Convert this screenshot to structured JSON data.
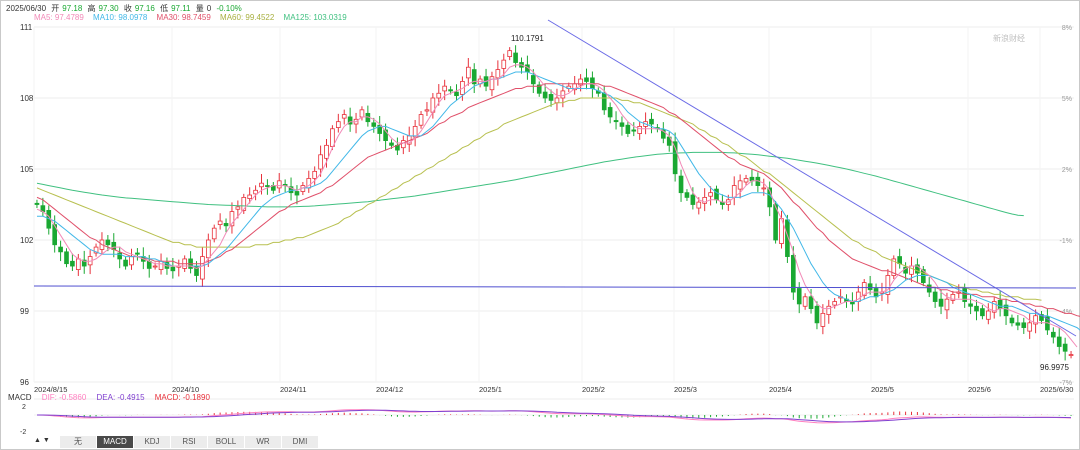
{
  "header": {
    "date": "2025/06/30",
    "open_label": "开",
    "open": "97.18",
    "high_label": "高",
    "high": "97.30",
    "close_label": "收",
    "close": "97.16",
    "low_label": "低",
    "low": "97.11",
    "vol_label": "量",
    "vol": "0",
    "change": "-0.10%"
  },
  "ma_legend": {
    "ma5": "MA5: 97.4789",
    "ma10": "MA10: 98.0978",
    "ma30": "MA30: 98.7459",
    "ma60": "MA60: 99.4522",
    "ma125": "MA125: 103.0319"
  },
  "macd_legend": {
    "title": "MACD",
    "dif": "DIF: -0.5860",
    "dea": "DEA: -0.4915",
    "macd": "MACD: -0.1890"
  },
  "watermark": "新浪财经",
  "annotations": {
    "high_label": "110.1791",
    "low_label": "96.9975"
  },
  "tabs": [
    "无",
    "MACD",
    "KDJ",
    "RSI",
    "BOLL",
    "WR",
    "DMI"
  ],
  "active_tab": "MACD",
  "colors": {
    "up": "#e8313b",
    "down": "#1aa832",
    "ma5": "#f28ab8",
    "ma10": "#42b8e8",
    "ma30": "#e0506a",
    "ma60": "#b8c050",
    "ma125": "#40c080",
    "trendline": "#6060e0",
    "support": "#5050d0",
    "dif": "#ff80c0",
    "dea": "#8040d0"
  },
  "chart_data": {
    "type": "candlestick",
    "y_ticks": [
      "111",
      "108",
      "105",
      "102",
      "99",
      "96"
    ],
    "y_right_ticks": [
      "8%",
      "5%",
      "2%",
      "-1%",
      "-4%",
      "-7%"
    ],
    "x_ticks": [
      "2024/8/15",
      "2024/10",
      "2024/11",
      "2024/12",
      "2025/1",
      "2025/2",
      "2025/3",
      "2025/4",
      "2025/5",
      "2025/6",
      "2025/6/30"
    ],
    "ylim": [
      96,
      111
    ],
    "macd_ticks": [
      "2",
      "-2"
    ],
    "closes": [
      103.5,
      103.2,
      102.5,
      101.8,
      101.5,
      101.0,
      100.9,
      101.2,
      100.9,
      101.3,
      101.7,
      102.0,
      101.8,
      101.6,
      101.2,
      100.9,
      101.3,
      101.4,
      101.1,
      100.8,
      100.9,
      101.1,
      100.8,
      100.7,
      100.9,
      101.2,
      100.8,
      100.5,
      101.3,
      102.0,
      102.5,
      102.8,
      102.6,
      103.2,
      103.4,
      103.8,
      103.9,
      104.1,
      104.4,
      104.3,
      104.1,
      104.5,
      104.3,
      104.0,
      103.9,
      104.3,
      104.6,
      104.9,
      105.6,
      106.0,
      106.7,
      107.0,
      107.3,
      106.9,
      107.1,
      107.5,
      107.0,
      106.8,
      106.5,
      106.2,
      106.0,
      105.8,
      106.2,
      106.4,
      106.8,
      107.3,
      107.5,
      108.0,
      108.2,
      108.5,
      108.3,
      108.1,
      108.7,
      109.3,
      108.6,
      108.8,
      108.5,
      108.9,
      109.2,
      109.6,
      110.0,
      109.5,
      109.3,
      109.1,
      108.6,
      108.2,
      108.0,
      107.9,
      108.0,
      108.3,
      108.5,
      108.6,
      108.8,
      108.7,
      108.4,
      108.2,
      107.5,
      107.2,
      107.0,
      106.8,
      106.5,
      106.6,
      106.8,
      107.0,
      106.9,
      106.7,
      106.3,
      106.0,
      104.8,
      104.0,
      103.8,
      103.5,
      103.6,
      103.8,
      104.0,
      103.7,
      103.5,
      103.7,
      104.3,
      104.5,
      104.6,
      104.5,
      104.3,
      104.2,
      103.4,
      102.0,
      102.9,
      101.3,
      99.8,
      99.3,
      99.6,
      99.1,
      98.5,
      98.9,
      99.2,
      99.4,
      99.6,
      99.4,
      99.3,
      99.8,
      100.2,
      99.9,
      99.6,
      99.8,
      100.5,
      101.2,
      101.0,
      100.6,
      100.9,
      100.6,
      100.2,
      99.8,
      99.4,
      99.2,
      99.5,
      99.7,
      99.8,
      99.4,
      99.2,
      99.0,
      98.8,
      99.0,
      99.4,
      99.1,
      98.8,
      98.5,
      98.4,
      98.3,
      98.5,
      98.8,
      98.6,
      98.2,
      97.9,
      97.5,
      97.3,
      97.16
    ],
    "ma5": [
      103.3,
      103.2,
      103.0,
      102.6,
      102.2,
      101.8,
      101.4,
      101.2,
      101.1,
      101.1,
      101.2,
      101.4,
      101.6,
      101.7,
      101.7,
      101.5,
      101.4,
      101.3,
      101.2,
      101.1,
      101.0,
      101.0,
      100.9,
      100.9,
      100.9,
      100.9,
      100.9,
      100.8,
      100.9,
      101.2,
      101.5,
      101.8,
      102.3,
      102.7,
      103.0,
      103.3,
      103.6,
      103.9,
      104.1,
      104.2,
      104.3,
      104.3,
      104.3,
      104.2,
      104.1,
      104.2,
      104.3,
      104.5,
      104.8,
      105.3,
      105.9,
      106.4,
      106.8,
      107.0,
      107.0,
      107.2,
      107.2,
      107.1,
      106.9,
      106.6,
      106.3,
      106.1,
      106.1,
      106.1,
      106.3,
      106.6,
      107.0,
      107.4,
      107.8,
      108.1,
      108.2,
      108.3,
      108.4,
      108.6,
      108.7,
      108.7,
      108.7,
      108.8,
      108.8,
      109.0,
      109.3,
      109.4,
      109.4,
      109.3,
      109.1,
      108.8,
      108.5,
      108.3,
      108.1,
      108.1,
      108.2,
      108.4,
      108.5,
      108.6,
      108.6,
      108.5,
      108.3,
      108.0,
      107.7,
      107.3,
      107.0,
      106.8,
      106.7,
      106.7,
      106.7,
      106.7,
      106.6,
      106.4,
      105.9,
      105.2,
      104.6,
      104.0,
      103.7,
      103.6,
      103.7,
      103.7,
      103.6,
      103.6,
      103.8,
      104.0,
      104.3,
      104.5,
      104.5,
      104.4,
      104.1,
      103.4,
      102.9,
      102.2,
      101.5,
      100.7,
      100.1,
      99.7,
      99.3,
      99.1,
      99.1,
      99.2,
      99.3,
      99.4,
      99.4,
      99.5,
      99.7,
      99.8,
      99.8,
      99.8,
      99.9,
      100.3,
      100.6,
      100.8,
      100.9,
      100.9,
      100.7,
      100.5,
      100.2,
      99.8,
      99.6,
      99.5,
      99.5,
      99.5,
      99.5,
      99.4,
      99.3,
      99.1,
      99.0,
      99.1,
      99.1,
      99.0,
      98.9,
      98.8,
      98.6,
      98.5,
      98.5,
      98.5,
      98.4,
      98.3,
      98.1,
      97.8,
      97.48
    ],
    "ma10": [
      103.0,
      103.0,
      102.9,
      102.8,
      102.6,
      102.4,
      102.2,
      102.0,
      101.8,
      101.6,
      101.5,
      101.4,
      101.4,
      101.4,
      101.4,
      101.3,
      101.3,
      101.3,
      101.3,
      101.2,
      101.2,
      101.1,
      101.0,
      100.9,
      100.9,
      100.9,
      100.9,
      100.9,
      100.9,
      101.0,
      101.2,
      101.4,
      101.6,
      101.9,
      102.2,
      102.5,
      102.8,
      103.1,
      103.4,
      103.6,
      103.8,
      103.9,
      104.0,
      104.1,
      104.1,
      104.2,
      104.2,
      104.3,
      104.4,
      104.6,
      104.9,
      105.2,
      105.5,
      105.8,
      106.1,
      106.4,
      106.6,
      106.7,
      106.8,
      106.8,
      106.7,
      106.6,
      106.5,
      106.4,
      106.4,
      106.4,
      106.6,
      106.8,
      107.1,
      107.4,
      107.7,
      107.9,
      108.1,
      108.3,
      108.5,
      108.6,
      108.7,
      108.8,
      108.8,
      108.9,
      109.0,
      109.1,
      109.1,
      109.1,
      109.0,
      108.9,
      108.8,
      108.7,
      108.6,
      108.5,
      108.4,
      108.4,
      108.4,
      108.4,
      108.4,
      108.3,
      108.2,
      108.1,
      107.9,
      107.7,
      107.4,
      107.2,
      107.0,
      106.9,
      106.8,
      106.7,
      106.7,
      106.6,
      106.4,
      106.0,
      105.6,
      105.2,
      104.8,
      104.5,
      104.2,
      104.0,
      103.9,
      103.8,
      103.8,
      103.8,
      103.9,
      104.0,
      104.0,
      104.0,
      103.9,
      103.6,
      103.3,
      102.9,
      102.5,
      102.0,
      101.5,
      101.0,
      100.6,
      100.2,
      99.9,
      99.7,
      99.6,
      99.5,
      99.4,
      99.4,
      99.5,
      99.6,
      99.6,
      99.7,
      99.8,
      99.9,
      100.1,
      100.3,
      100.4,
      100.5,
      100.5,
      100.5,
      100.4,
      100.3,
      100.2,
      100.0,
      99.9,
      99.8,
      99.7,
      99.6,
      99.5,
      99.4,
      99.3,
      99.2,
      99.2,
      99.2,
      99.1,
      99.0,
      98.9,
      98.9,
      98.8,
      98.8,
      98.7,
      98.6,
      98.5,
      98.4,
      98.3,
      98.1
    ],
    "ma30": [
      103.8,
      103.7,
      103.5,
      103.3,
      103.1,
      102.9,
      102.7,
      102.5,
      102.3,
      102.1,
      102.0,
      101.8,
      101.7,
      101.6,
      101.5,
      101.4,
      101.3,
      101.3,
      101.2,
      101.2,
      101.1,
      101.1,
      101.1,
      101.1,
      101.0,
      101.0,
      101.0,
      101.0,
      101.0,
      101.1,
      101.2,
      101.3,
      101.5,
      101.6,
      101.8,
      102.0,
      102.2,
      102.4,
      102.6,
      102.8,
      103.0,
      103.2,
      103.3,
      103.5,
      103.6,
      103.7,
      103.8,
      103.9,
      104.0,
      104.2,
      104.3,
      104.5,
      104.7,
      104.9,
      105.1,
      105.3,
      105.5,
      105.6,
      105.7,
      105.8,
      105.9,
      106.0,
      106.1,
      106.2,
      106.3,
      106.4,
      106.5,
      106.7,
      106.9,
      107.0,
      107.2,
      107.3,
      107.4,
      107.6,
      107.7,
      107.8,
      107.9,
      108.0,
      108.1,
      108.2,
      108.3,
      108.4,
      108.4,
      108.5,
      108.5,
      108.5,
      108.6,
      108.6,
      108.6,
      108.6,
      108.6,
      108.6,
      108.6,
      108.6,
      108.6,
      108.6,
      108.5,
      108.5,
      108.4,
      108.3,
      108.2,
      108.1,
      108.0,
      107.9,
      107.8,
      107.7,
      107.6,
      107.4,
      107.3,
      107.1,
      106.9,
      106.7,
      106.5,
      106.3,
      106.1,
      105.9,
      105.7,
      105.5,
      105.4,
      105.2,
      105.1,
      105.0,
      104.9,
      104.8,
      104.6,
      104.4,
      104.2,
      103.9,
      103.6,
      103.4,
      103.1,
      102.8,
      102.5,
      102.3,
      102.0,
      101.8,
      101.6,
      101.4,
      101.2,
      101.1,
      101.0,
      100.9,
      100.8,
      100.7,
      100.7,
      100.6,
      100.5,
      100.4,
      100.3,
      100.2,
      100.1,
      100.0,
      100.0,
      99.9,
      99.9,
      99.8,
      99.8,
      99.7,
      99.7,
      99.7,
      99.6,
      99.6,
      99.6,
      99.5,
      99.5,
      99.4,
      99.4,
      99.3,
      99.3,
      99.2,
      99.2,
      99.1,
      99.1,
      99.0,
      98.9,
      98.9,
      98.8,
      98.75
    ],
    "ma60": [
      104.2,
      104.1,
      104.0,
      103.9,
      103.8,
      103.7,
      103.6,
      103.5,
      103.4,
      103.3,
      103.2,
      103.1,
      103.0,
      102.9,
      102.8,
      102.7,
      102.6,
      102.5,
      102.4,
      102.3,
      102.2,
      102.1,
      102.0,
      101.9,
      101.9,
      101.8,
      101.8,
      101.7,
      101.7,
      101.7,
      101.7,
      101.7,
      101.7,
      101.7,
      101.7,
      101.7,
      101.7,
      101.8,
      101.8,
      101.8,
      101.9,
      101.9,
      102.0,
      102.0,
      102.1,
      102.1,
      102.2,
      102.3,
      102.4,
      102.5,
      102.6,
      102.7,
      102.9,
      103.0,
      103.2,
      103.3,
      103.5,
      103.6,
      103.8,
      103.9,
      104.1,
      104.2,
      104.4,
      104.5,
      104.7,
      104.8,
      105.0,
      105.1,
      105.3,
      105.4,
      105.6,
      105.7,
      105.9,
      106.0,
      106.2,
      106.3,
      106.5,
      106.6,
      106.7,
      106.9,
      107.0,
      107.1,
      107.2,
      107.3,
      107.4,
      107.5,
      107.6,
      107.7,
      107.8,
      107.8,
      107.9,
      107.9,
      108.0,
      108.0,
      108.0,
      108.0,
      108.0,
      108.0,
      108.0,
      107.9,
      107.9,
      107.8,
      107.8,
      107.7,
      107.6,
      107.5,
      107.4,
      107.3,
      107.2,
      107.1,
      107.0,
      106.9,
      106.7,
      106.6,
      106.4,
      106.3,
      106.1,
      106.0,
      105.8,
      105.6,
      105.5,
      105.3,
      105.1,
      104.9,
      104.8,
      104.6,
      104.4,
      104.2,
      104.0,
      103.8,
      103.6,
      103.4,
      103.2,
      103.0,
      102.8,
      102.6,
      102.4,
      102.2,
      102.0,
      101.9,
      101.7,
      101.6,
      101.5,
      101.3,
      101.2,
      101.1,
      101.0,
      100.9,
      100.8,
      100.7,
      100.6,
      100.5,
      100.4,
      100.3,
      100.2,
      100.1,
      100.0,
      100.0,
      99.9,
      99.9,
      99.8,
      99.8,
      99.7,
      99.7,
      99.6,
      99.6,
      99.6,
      99.5,
      99.5,
      99.5,
      99.45
    ],
    "ma125": [
      104.4,
      104.35,
      104.3,
      104.25,
      104.2,
      104.15,
      104.1,
      104.06,
      104.02,
      103.98,
      103.94,
      103.9,
      103.87,
      103.84,
      103.81,
      103.78,
      103.76,
      103.74,
      103.72,
      103.7,
      103.68,
      103.66,
      103.64,
      103.62,
      103.6,
      103.58,
      103.56,
      103.54,
      103.52,
      103.5,
      103.49,
      103.48,
      103.47,
      103.46,
      103.45,
      103.44,
      103.43,
      103.42,
      103.41,
      103.4,
      103.4,
      103.4,
      103.4,
      103.4,
      103.41,
      103.42,
      103.43,
      103.44,
      103.46,
      103.48,
      103.5,
      103.52,
      103.54,
      103.56,
      103.58,
      103.6,
      103.62,
      103.65,
      103.68,
      103.71,
      103.74,
      103.77,
      103.8,
      103.83,
      103.86,
      103.9,
      103.94,
      103.98,
      104.02,
      104.06,
      104.1,
      104.14,
      104.18,
      104.22,
      104.26,
      104.3,
      104.34,
      104.38,
      104.42,
      104.46,
      104.5,
      104.55,
      104.6,
      104.65,
      104.7,
      104.75,
      104.8,
      104.85,
      104.9,
      104.95,
      105.0,
      105.05,
      105.1,
      105.15,
      105.2,
      105.25,
      105.3,
      105.34,
      105.38,
      105.42,
      105.46,
      105.5,
      105.53,
      105.56,
      105.59,
      105.62,
      105.64,
      105.66,
      105.67,
      105.68,
      105.69,
      105.7,
      105.7,
      105.7,
      105.7,
      105.7,
      105.7,
      105.69,
      105.68,
      105.66,
      105.64,
      105.62,
      105.6,
      105.57,
      105.54,
      105.51,
      105.48,
      105.45,
      105.41,
      105.37,
      105.33,
      105.29,
      105.25,
      105.2,
      105.15,
      105.1,
      105.05,
      105.0,
      104.94,
      104.88,
      104.82,
      104.76,
      104.7,
      104.63,
      104.56,
      104.49,
      104.42,
      104.35,
      104.28,
      104.21,
      104.14,
      104.07,
      104.0,
      103.93,
      103.86,
      103.79,
      103.72,
      103.65,
      103.58,
      103.51,
      103.44,
      103.37,
      103.3,
      103.23,
      103.16,
      103.1,
      103.05,
      103.03
    ]
  }
}
